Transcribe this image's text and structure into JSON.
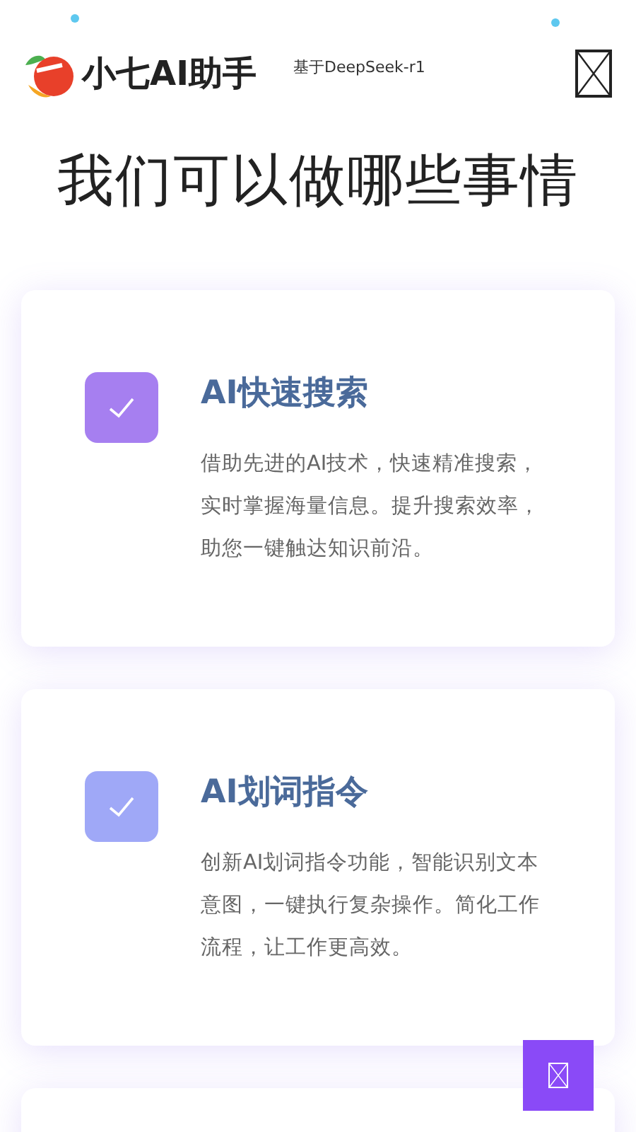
{
  "header": {
    "brand": "小七AI助手",
    "model": "基于DeepSeek-r1"
  },
  "heading": "我们可以做哪些事情",
  "features": [
    {
      "kind": "feature",
      "title": "AI快速搜索",
      "description": "借助先进的AI技术，快速精准搜索，实时掌握海量信息。提升搜索效率，助您一键触达知识前沿。",
      "color": "#a67ff0"
    },
    {
      "kind": "feature",
      "title": "AI划词指令",
      "description": "创新AI划词指令功能，智能识别文本意图，一键执行复杂操作。简化工作流程，让工作更高效。",
      "color": "#9fa8f7"
    },
    {
      "kind": "empty"
    }
  ]
}
